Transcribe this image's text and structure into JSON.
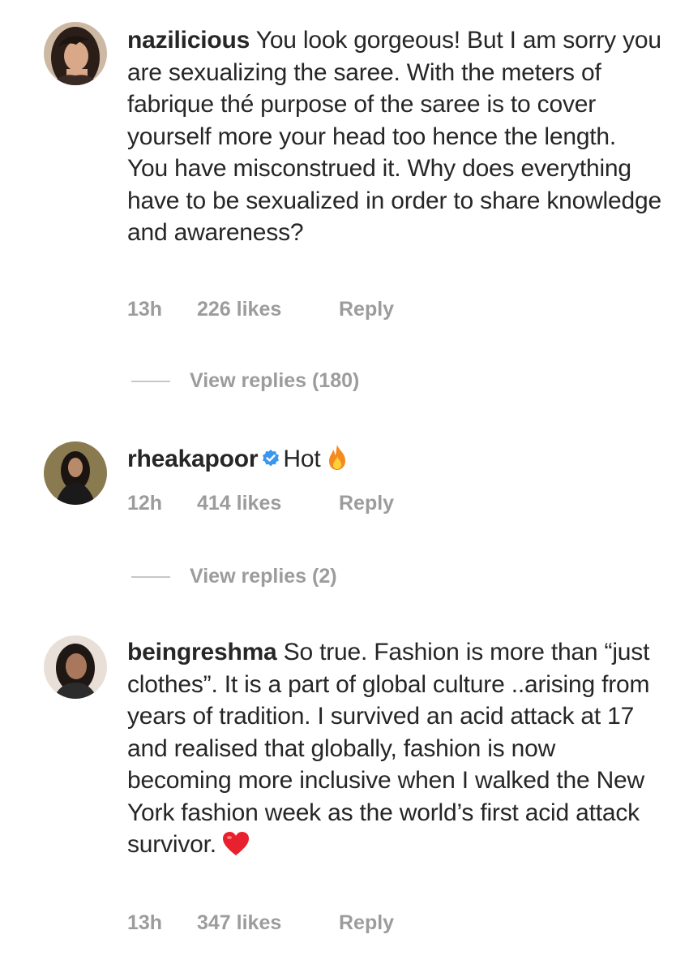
{
  "comments": [
    {
      "username": "nazilicious",
      "text": "You look gorgeous! But I am sorry you are sexualizing the saree. With the meters of fabrique thé purpose of the saree is to cover yourself more your head too hence the length. You have misconstrued it. Why does everything have to be sexualized in order to share knowledge and awareness?",
      "time": "13h",
      "likes": "226 likes",
      "reply_label": "Reply",
      "view_replies": "View replies (180)",
      "verified": false,
      "avatar_icon": "profile-photo-woman-long-hair"
    },
    {
      "username": "rheakapoor",
      "text": "Hot",
      "emoji": "fire-emoji",
      "time": "12h",
      "likes": "414 likes",
      "reply_label": "Reply",
      "view_replies": "View replies (2)",
      "verified": true,
      "avatar_icon": "profile-photo-woman-dark"
    },
    {
      "username": "beingreshma",
      "text": "So true. Fashion is more than “just clothes”. It is a part of global culture ..arising from years of tradition. I survived an acid attack at 17 and realised that globally, fashion is now becoming more inclusive when I walked the New York fashion week as the world’s first acid attack survivor.",
      "emoji": "red-heart-emoji",
      "time": "13h",
      "likes": "347 likes",
      "reply_label": "Reply",
      "verified": false,
      "avatar_icon": "profile-photo-woman-portrait"
    }
  ],
  "colors": {
    "text": "#262626",
    "meta": "#9c9c9c",
    "verified": "#3897f0",
    "heart": "#e8212e",
    "fire": "#f58a1f"
  }
}
